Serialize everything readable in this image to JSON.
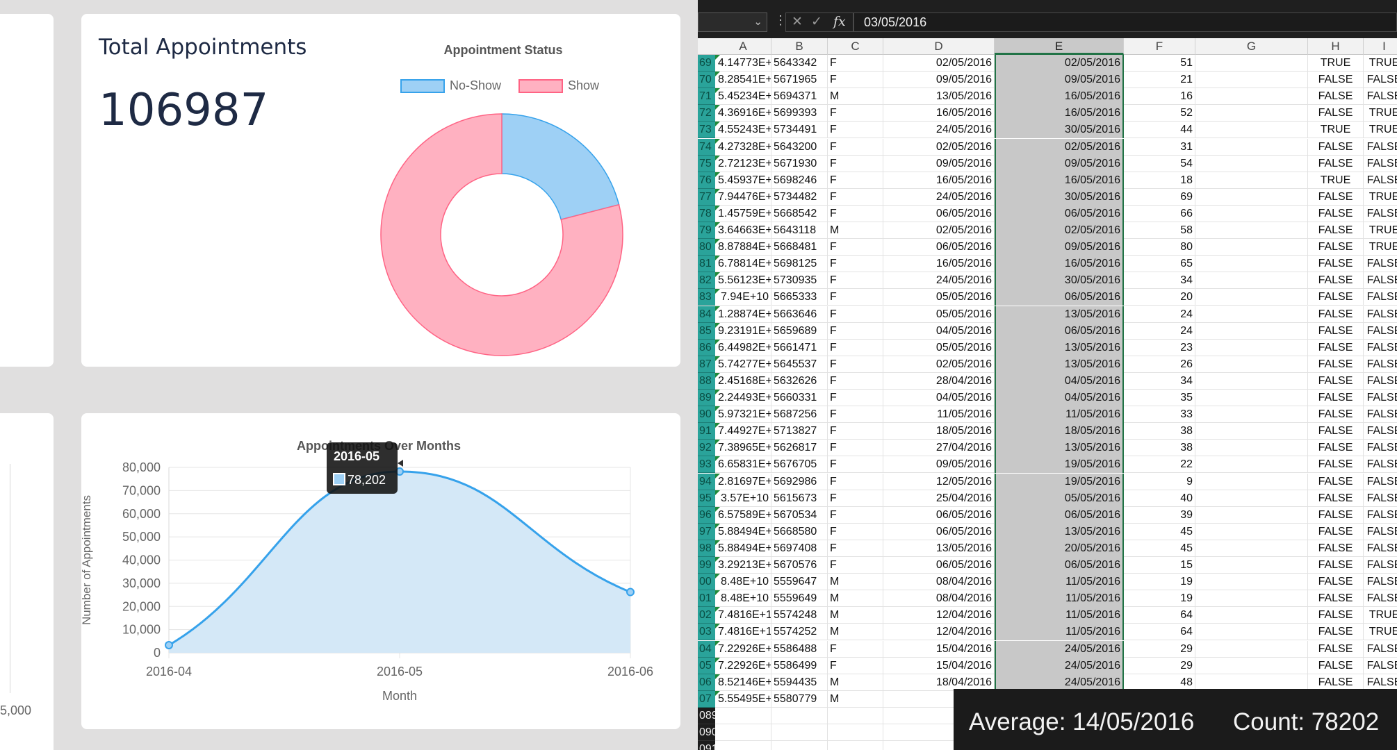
{
  "dashboard": {
    "total_card": {
      "title": "Total Appointments",
      "value": "106987"
    },
    "partial_left_tick": "5,000"
  },
  "chart_data": [
    {
      "type": "pie",
      "title": "Appointment Status",
      "legend_position": "top",
      "labels": [
        "No-Show",
        "Show"
      ],
      "values": [
        21,
        79
      ],
      "colors": [
        "#9ed0f5",
        "#ffb1c1"
      ],
      "border_colors": [
        "#36a2eb",
        "#ff6384"
      ],
      "donut": true
    },
    {
      "type": "area",
      "title": "Appointments Over Months",
      "xlabel": "Month",
      "ylabel": "Number of Appointments",
      "categories": [
        "2016-04",
        "2016-05",
        "2016-06"
      ],
      "series": [
        {
          "values": [
            3300,
            78202,
            26200
          ]
        }
      ],
      "ylim": [
        0,
        80000
      ],
      "yticks": [
        0,
        10000,
        20000,
        30000,
        40000,
        50000,
        60000,
        70000,
        80000
      ],
      "ytick_labels": [
        "0",
        "10,000",
        "20,000",
        "30,000",
        "40,000",
        "50,000",
        "60,000",
        "70,000",
        "80,000"
      ],
      "grid": true,
      "line_color": "#36a2eb",
      "fill_color": "#d4e8f7",
      "tooltip": {
        "title": "2016-05",
        "value": "78,202"
      }
    }
  ],
  "sheet": {
    "formula_value": "03/05/2016",
    "fx_label": "fx",
    "columns": [
      "A",
      "B",
      "C",
      "D",
      "E",
      "F",
      "G",
      "H",
      "I"
    ],
    "selected_column": "E",
    "rows": [
      {
        "n": "69",
        "A": "4.14773E+",
        "B": "5643342",
        "C": "F",
        "D": "02/05/2016",
        "E": "02/05/2016",
        "F": "51",
        "H": "TRUE",
        "I": "TRUE"
      },
      {
        "n": "70",
        "A": "8.28541E+",
        "B": "5671965",
        "C": "F",
        "D": "09/05/2016",
        "E": "09/05/2016",
        "F": "21",
        "H": "FALSE",
        "I": "FALSE"
      },
      {
        "n": "71",
        "A": "5.45234E+",
        "B": "5694371",
        "C": "M",
        "D": "13/05/2016",
        "E": "16/05/2016",
        "F": "16",
        "H": "FALSE",
        "I": "FALSE"
      },
      {
        "n": "72",
        "A": "4.36916E+",
        "B": "5699393",
        "C": "F",
        "D": "16/05/2016",
        "E": "16/05/2016",
        "F": "52",
        "H": "FALSE",
        "I": "TRUE"
      },
      {
        "n": "73",
        "A": "4.55243E+",
        "B": "5734491",
        "C": "F",
        "D": "24/05/2016",
        "E": "30/05/2016",
        "F": "44",
        "H": "TRUE",
        "I": "TRUE"
      },
      {
        "n": "74",
        "A": "4.27328E+",
        "B": "5643200",
        "C": "F",
        "D": "02/05/2016",
        "E": "02/05/2016",
        "F": "31",
        "H": "FALSE",
        "I": "FALSE"
      },
      {
        "n": "75",
        "A": "2.72123E+",
        "B": "5671930",
        "C": "F",
        "D": "09/05/2016",
        "E": "09/05/2016",
        "F": "54",
        "H": "FALSE",
        "I": "FALSE"
      },
      {
        "n": "76",
        "A": "5.45937E+",
        "B": "5698246",
        "C": "F",
        "D": "16/05/2016",
        "E": "16/05/2016",
        "F": "18",
        "H": "TRUE",
        "I": "FALSE"
      },
      {
        "n": "77",
        "A": "7.94476E+",
        "B": "5734482",
        "C": "F",
        "D": "24/05/2016",
        "E": "30/05/2016",
        "F": "69",
        "H": "FALSE",
        "I": "TRUE"
      },
      {
        "n": "78",
        "A": "1.45759E+",
        "B": "5668542",
        "C": "F",
        "D": "06/05/2016",
        "E": "06/05/2016",
        "F": "66",
        "H": "FALSE",
        "I": "FALSE"
      },
      {
        "n": "79",
        "A": "3.64663E+",
        "B": "5643118",
        "C": "M",
        "D": "02/05/2016",
        "E": "02/05/2016",
        "F": "58",
        "H": "FALSE",
        "I": "TRUE"
      },
      {
        "n": "80",
        "A": "8.87884E+",
        "B": "5668481",
        "C": "F",
        "D": "06/05/2016",
        "E": "09/05/2016",
        "F": "80",
        "H": "FALSE",
        "I": "TRUE"
      },
      {
        "n": "81",
        "A": "6.78814E+",
        "B": "5698125",
        "C": "F",
        "D": "16/05/2016",
        "E": "16/05/2016",
        "F": "65",
        "H": "FALSE",
        "I": "FALSE"
      },
      {
        "n": "82",
        "A": "5.56123E+",
        "B": "5730935",
        "C": "F",
        "D": "24/05/2016",
        "E": "30/05/2016",
        "F": "34",
        "H": "FALSE",
        "I": "FALSE"
      },
      {
        "n": "83",
        "A": "7.94E+10",
        "B": "5665333",
        "C": "F",
        "D": "05/05/2016",
        "E": "06/05/2016",
        "F": "20",
        "H": "FALSE",
        "I": "FALSE"
      },
      {
        "n": "84",
        "A": "1.28874E+",
        "B": "5663646",
        "C": "F",
        "D": "05/05/2016",
        "E": "13/05/2016",
        "F": "24",
        "H": "FALSE",
        "I": "FALSE"
      },
      {
        "n": "85",
        "A": "9.23191E+",
        "B": "5659689",
        "C": "F",
        "D": "04/05/2016",
        "E": "06/05/2016",
        "F": "24",
        "H": "FALSE",
        "I": "FALSE"
      },
      {
        "n": "86",
        "A": "6.44982E+",
        "B": "5661471",
        "C": "F",
        "D": "05/05/2016",
        "E": "13/05/2016",
        "F": "23",
        "H": "FALSE",
        "I": "FALSE"
      },
      {
        "n": "87",
        "A": "5.74277E+",
        "B": "5645537",
        "C": "F",
        "D": "02/05/2016",
        "E": "13/05/2016",
        "F": "26",
        "H": "FALSE",
        "I": "FALSE"
      },
      {
        "n": "88",
        "A": "2.45168E+",
        "B": "5632626",
        "C": "F",
        "D": "28/04/2016",
        "E": "04/05/2016",
        "F": "34",
        "H": "FALSE",
        "I": "FALSE"
      },
      {
        "n": "89",
        "A": "2.24493E+",
        "B": "5660331",
        "C": "F",
        "D": "04/05/2016",
        "E": "04/05/2016",
        "F": "35",
        "H": "FALSE",
        "I": "FALSE"
      },
      {
        "n": "90",
        "A": "5.97321E+",
        "B": "5687256",
        "C": "F",
        "D": "11/05/2016",
        "E": "11/05/2016",
        "F": "33",
        "H": "FALSE",
        "I": "FALSE"
      },
      {
        "n": "91",
        "A": "7.44927E+",
        "B": "5713827",
        "C": "F",
        "D": "18/05/2016",
        "E": "18/05/2016",
        "F": "38",
        "H": "FALSE",
        "I": "FALSE"
      },
      {
        "n": "92",
        "A": "7.38965E+",
        "B": "5626817",
        "C": "F",
        "D": "27/04/2016",
        "E": "13/05/2016",
        "F": "38",
        "H": "FALSE",
        "I": "FALSE"
      },
      {
        "n": "93",
        "A": "6.65831E+",
        "B": "5676705",
        "C": "F",
        "D": "09/05/2016",
        "E": "19/05/2016",
        "F": "22",
        "H": "FALSE",
        "I": "FALSE"
      },
      {
        "n": "94",
        "A": "2.81697E+",
        "B": "5692986",
        "C": "F",
        "D": "12/05/2016",
        "E": "19/05/2016",
        "F": "9",
        "H": "FALSE",
        "I": "FALSE"
      },
      {
        "n": "95",
        "A": "3.57E+10",
        "B": "5615673",
        "C": "F",
        "D": "25/04/2016",
        "E": "05/05/2016",
        "F": "40",
        "H": "FALSE",
        "I": "FALSE"
      },
      {
        "n": "96",
        "A": "6.57589E+",
        "B": "5670534",
        "C": "F",
        "D": "06/05/2016",
        "E": "06/05/2016",
        "F": "39",
        "H": "FALSE",
        "I": "FALSE"
      },
      {
        "n": "97",
        "A": "5.88494E+",
        "B": "5668580",
        "C": "F",
        "D": "06/05/2016",
        "E": "13/05/2016",
        "F": "45",
        "H": "FALSE",
        "I": "FALSE"
      },
      {
        "n": "98",
        "A": "5.88494E+",
        "B": "5697408",
        "C": "F",
        "D": "13/05/2016",
        "E": "20/05/2016",
        "F": "45",
        "H": "FALSE",
        "I": "FALSE"
      },
      {
        "n": "99",
        "A": "3.29213E+",
        "B": "5670576",
        "C": "F",
        "D": "06/05/2016",
        "E": "06/05/2016",
        "F": "15",
        "H": "FALSE",
        "I": "FALSE"
      },
      {
        "n": "00",
        "A": "8.48E+10",
        "B": "5559647",
        "C": "M",
        "D": "08/04/2016",
        "E": "11/05/2016",
        "F": "19",
        "H": "FALSE",
        "I": "FALSE"
      },
      {
        "n": "01",
        "A": "8.48E+10",
        "B": "5559649",
        "C": "M",
        "D": "08/04/2016",
        "E": "11/05/2016",
        "F": "19",
        "H": "FALSE",
        "I": "FALSE"
      },
      {
        "n": "02",
        "A": "7.4816E+1",
        "B": "5574248",
        "C": "M",
        "D": "12/04/2016",
        "E": "11/05/2016",
        "F": "64",
        "H": "FALSE",
        "I": "TRUE"
      },
      {
        "n": "03",
        "A": "7.4816E+1",
        "B": "5574252",
        "C": "M",
        "D": "12/04/2016",
        "E": "11/05/2016",
        "F": "64",
        "H": "FALSE",
        "I": "TRUE"
      },
      {
        "n": "04",
        "A": "7.22926E+",
        "B": "5586488",
        "C": "F",
        "D": "15/04/2016",
        "E": "24/05/2016",
        "F": "29",
        "H": "FALSE",
        "I": "FALSE"
      },
      {
        "n": "05",
        "A": "7.22926E+",
        "B": "5586499",
        "C": "F",
        "D": "15/04/2016",
        "E": "24/05/2016",
        "F": "29",
        "H": "FALSE",
        "I": "FALSE"
      },
      {
        "n": "06",
        "A": "8.52146E+",
        "B": "5594435",
        "C": "M",
        "D": "18/04/2016",
        "E": "24/05/2016",
        "F": "48",
        "H": "FALSE",
        "I": "FALSE"
      },
      {
        "n": "07",
        "A": "5.55495E+",
        "B": "5580779",
        "C": "M",
        "D": "14/0",
        "E": "",
        "F": "",
        "H": "",
        "I": ""
      },
      {
        "n": "089",
        "A": "",
        "B": "",
        "C": "",
        "D": "",
        "E": "",
        "F": "",
        "H": "",
        "I": ""
      },
      {
        "n": "090",
        "A": "",
        "B": "",
        "C": "",
        "D": "",
        "E": "",
        "F": "",
        "H": "",
        "I": ""
      },
      {
        "n": "091",
        "A": "",
        "B": "",
        "C": "",
        "D": "",
        "E": "",
        "F": "",
        "H": "",
        "I": ""
      }
    ],
    "status": {
      "average": "Average: 14/05/2016",
      "count": "Count: 78202"
    }
  }
}
